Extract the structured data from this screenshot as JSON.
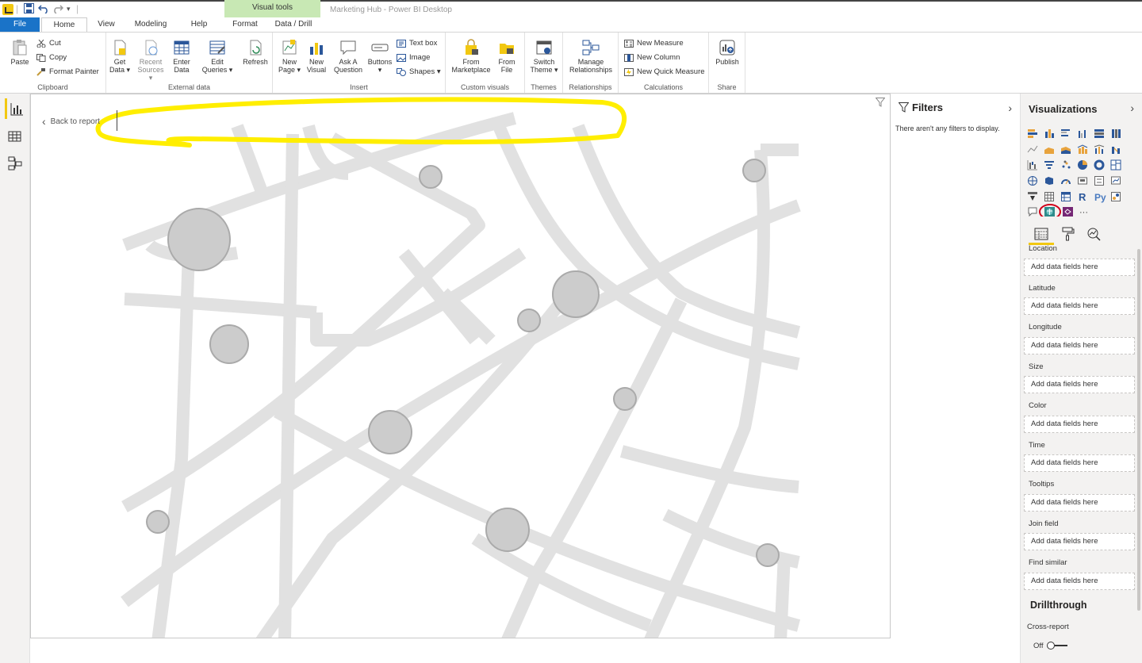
{
  "window": {
    "title": "Marketing Hub - Power BI Desktop",
    "context_tab_header": "Visual tools"
  },
  "tabs": [
    {
      "label": "File"
    },
    {
      "label": "Home"
    },
    {
      "label": "View"
    },
    {
      "label": "Modeling"
    },
    {
      "label": "Help"
    },
    {
      "label": "Format"
    },
    {
      "label": "Data / Drill"
    }
  ],
  "ribbon": {
    "clipboard": {
      "label": "Clipboard",
      "paste": "Paste",
      "cut": "Cut",
      "copy": "Copy",
      "format_painter": "Format Painter"
    },
    "external_data": {
      "label": "External data",
      "get_data": [
        "Get",
        "Data ▾"
      ],
      "recent_sources": [
        "Recent",
        "Sources ▾"
      ],
      "enter_data": [
        "Enter",
        "Data"
      ],
      "edit_queries": [
        "Edit",
        "Queries ▾"
      ],
      "refresh": "Refresh"
    },
    "insert": {
      "label": "Insert",
      "new_page": [
        "New",
        "Page ▾"
      ],
      "new_visual": [
        "New",
        "Visual"
      ],
      "ask_question": [
        "Ask A",
        "Question"
      ],
      "buttons": [
        "Buttons",
        "▾"
      ],
      "text_box": "Text box",
      "image": "Image",
      "shapes": "Shapes ▾"
    },
    "custom_visuals": {
      "label": "Custom visuals",
      "from_marketplace": [
        "From",
        "Marketplace"
      ],
      "from_file": [
        "From",
        "File"
      ]
    },
    "themes": {
      "label": "Themes",
      "switch_theme": [
        "Switch",
        "Theme ▾"
      ]
    },
    "relationships": {
      "label": "Relationships",
      "manage": [
        "Manage",
        "Relationships"
      ]
    },
    "calculations": {
      "label": "Calculations",
      "new_measure": "New Measure",
      "new_column": "New Column",
      "new_quick_measure": "New Quick Measure"
    },
    "share": {
      "label": "Share",
      "publish": "Publish"
    }
  },
  "canvas": {
    "back_to_report": "Back to report"
  },
  "filters": {
    "title": "Filters",
    "empty_message": "There aren't any filters to display."
  },
  "visualizations": {
    "title": "Visualizations",
    "wells": [
      {
        "label": "Location",
        "placeholder": "Add data fields here"
      },
      {
        "label": "Latitude",
        "placeholder": "Add data fields here"
      },
      {
        "label": "Longitude",
        "placeholder": "Add data fields here"
      },
      {
        "label": "Size",
        "placeholder": "Add data fields here"
      },
      {
        "label": "Color",
        "placeholder": "Add data fields here"
      },
      {
        "label": "Time",
        "placeholder": "Add data fields here"
      },
      {
        "label": "Tooltips",
        "placeholder": "Add data fields here"
      },
      {
        "label": "Join field",
        "placeholder": "Add data fields here"
      },
      {
        "label": "Find similar",
        "placeholder": "Add data fields here"
      }
    ],
    "drillthrough": {
      "title": "Drillthrough",
      "cross_report": "Cross-report",
      "toggle_state": "Off"
    },
    "more": "···"
  },
  "colors": {
    "accent_yellow": "#f2c811",
    "file_tab_blue": "#1a73c8",
    "context_tab_green": "#c8e8b4",
    "highlight_annotation": "#ffee00",
    "selected_visual_ring": "#d0021b",
    "map_road": "#e1e1e1",
    "map_bubble": "#cccccc"
  }
}
